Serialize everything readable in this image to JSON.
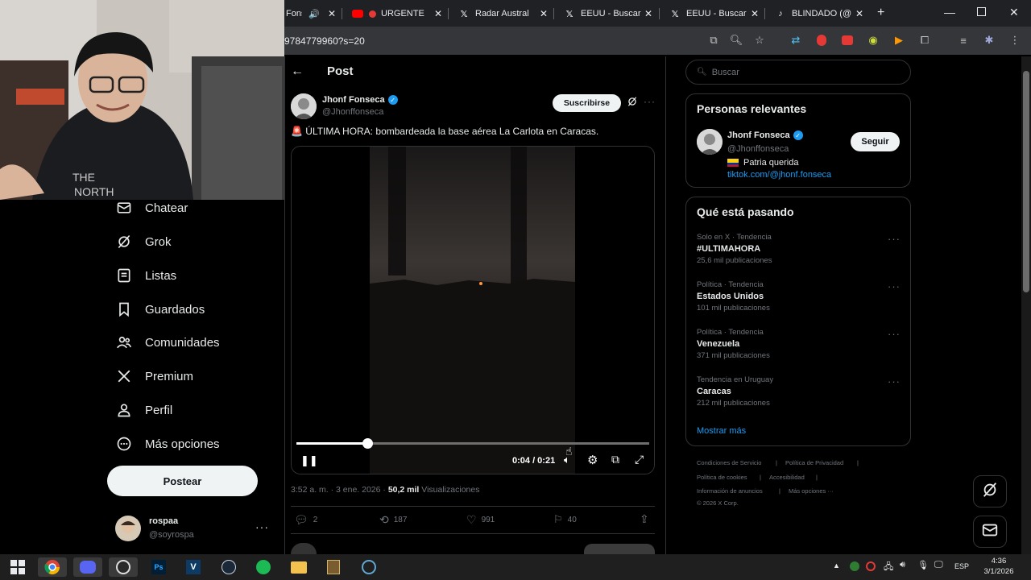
{
  "browser": {
    "tabs": [
      {
        "label": "Fonseca",
        "icon": "speaker-icon"
      },
      {
        "label": "URGENTE",
        "icon": "youtube-icon"
      },
      {
        "label": "Radar Austral",
        "icon": "x-logo-icon"
      },
      {
        "label": "EEUU - Buscar",
        "icon": "x-logo-icon"
      },
      {
        "label": "EEUU - Buscar",
        "icon": "x-logo-icon"
      },
      {
        "label": "BLINDADO (@",
        "icon": "tiktok-icon"
      }
    ],
    "url_fragment": "9784779960?s=20"
  },
  "nav": {
    "items": [
      {
        "label": "Chatear",
        "icon": "mail-icon"
      },
      {
        "label": "Grok",
        "icon": "grok-icon"
      },
      {
        "label": "Listas",
        "icon": "list-icon"
      },
      {
        "label": "Guardados",
        "icon": "bookmark-icon"
      },
      {
        "label": "Comunidades",
        "icon": "people-icon"
      },
      {
        "label": "Premium",
        "icon": "x-logo-icon"
      },
      {
        "label": "Perfil",
        "icon": "person-icon"
      },
      {
        "label": "Más opciones",
        "icon": "more-circle-icon"
      }
    ],
    "post_button": "Postear",
    "account": {
      "name": "rospaa",
      "handle": "@soyrospa"
    }
  },
  "post": {
    "header": "Post",
    "author": {
      "name": "Jhonf Fonseca",
      "handle": "@Jhonffonseca",
      "verified": true
    },
    "subscribe": "Suscribirse",
    "text": "🚨 ÚLTIMA HORA: bombardeada la base aérea La Carlota en Caracas.",
    "video": {
      "time": "0:04 / 0:21",
      "progress": 0.2
    },
    "timestamp": "3:52 a. m. · 3 ene. 2026 · ",
    "views_count": "50,2 mil",
    "views_label": " Visualizaciones",
    "stats": {
      "replies": "2",
      "reposts": "187",
      "likes": "991",
      "bookmarks": "40"
    }
  },
  "sidebar": {
    "search_placeholder": "Buscar",
    "relevant_title": "Personas relevantes",
    "person": {
      "name": "Jhonf Fonseca",
      "handle": "@Jhonffonseca",
      "bio": "Patria querida",
      "link": "tiktok.com/@jhonf.fonseca",
      "follow": "Seguir"
    },
    "trends_title": "Qué está pasando",
    "trends": [
      {
        "meta": "Solo en X · Tendencia",
        "name": "#ULTIMAHORA",
        "count": "25,6 mil publicaciones"
      },
      {
        "meta": "Política · Tendencia",
        "name": "Estados Unidos",
        "count": "101 mil publicaciones"
      },
      {
        "meta": "Política · Tendencia",
        "name": "Venezuela",
        "count": "371 mil publicaciones"
      },
      {
        "meta": "Tendencia en Uruguay",
        "name": "Caracas",
        "count": "212 mil publicaciones"
      }
    ],
    "show_more": "Mostrar más",
    "footer": {
      "terms": "Condiciones de Servicio",
      "privacy": "Política de Privacidad",
      "cookies": "Política de cookies",
      "accessibility": "Accesibilidad",
      "ads": "Información de anuncios",
      "more": "Más opciones ···",
      "copyright": "© 2026 X Corp."
    }
  },
  "taskbar": {
    "lang": "ESP",
    "time": "4:36",
    "date": "3/1/2026"
  },
  "colors": {
    "accent": "#1d9bf0",
    "background": "#000000",
    "text": "#e7e9ea",
    "muted": "#71767b"
  }
}
